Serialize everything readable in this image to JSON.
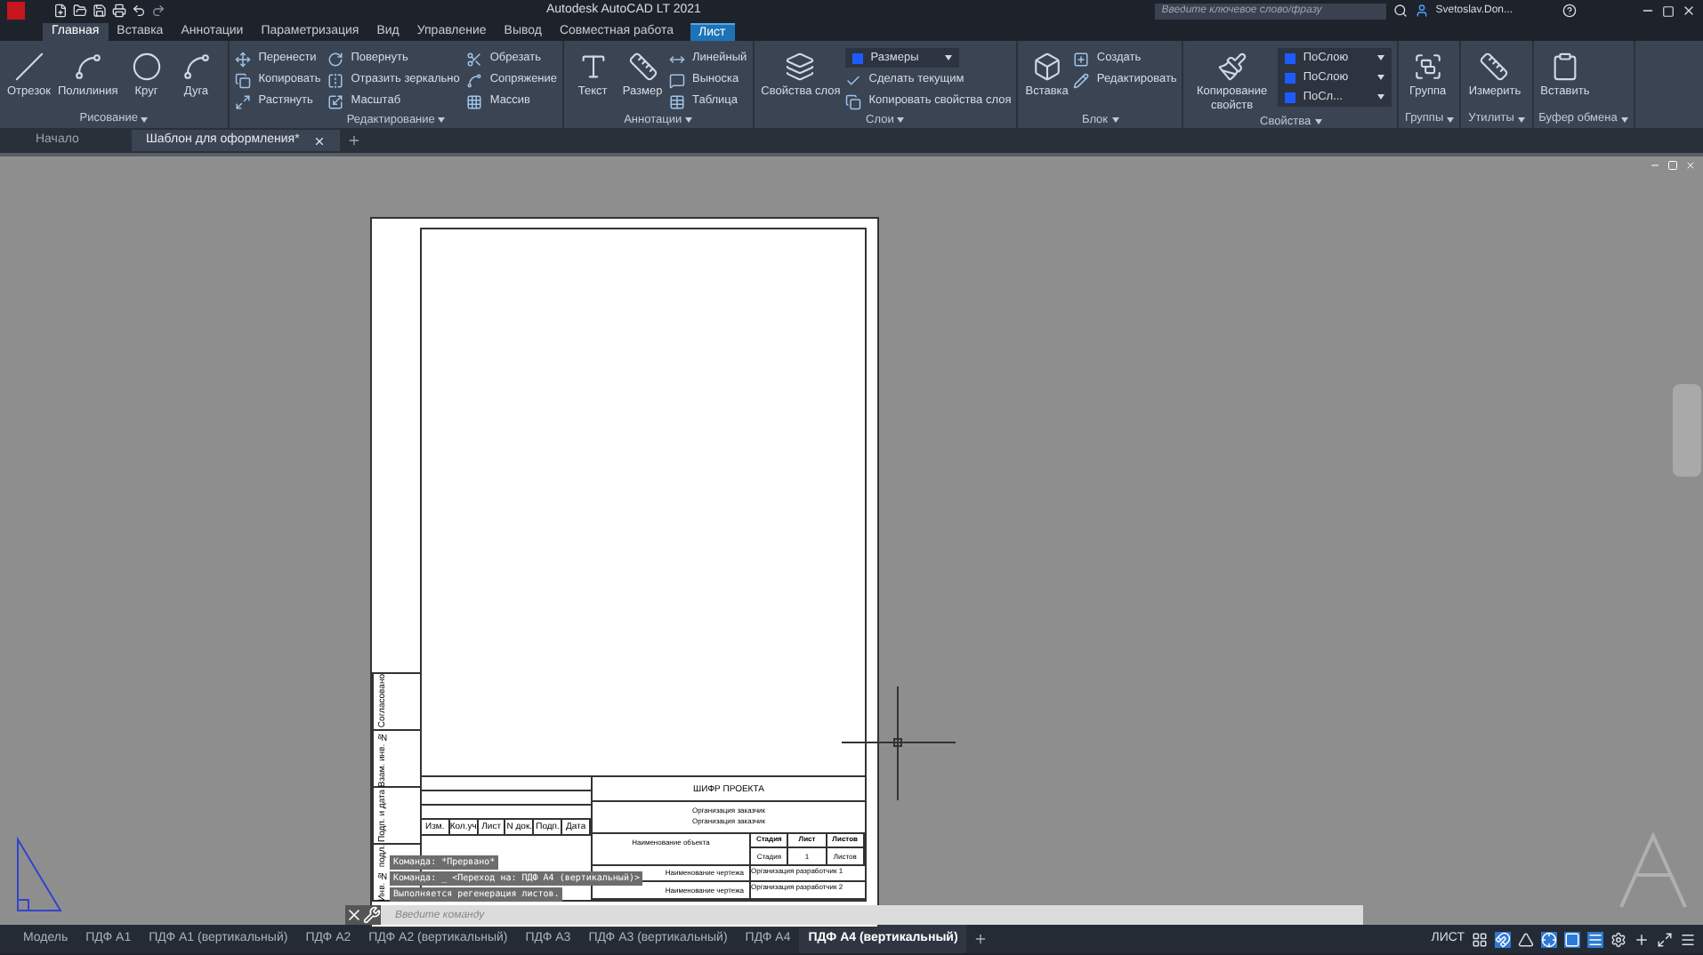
{
  "title_bar": {
    "title": "Autodesk AutoCAD LT 2021",
    "search": {
      "placeholder": "Введите ключевое слово/фразу"
    },
    "user": "Svetoslav.Don..."
  },
  "ribbon_tabs": [
    {
      "label": "Главная",
      "selected": true,
      "contextual": false
    },
    {
      "label": "Вставка",
      "selected": false,
      "contextual": false
    },
    {
      "label": "Аннотации",
      "selected": false,
      "contextual": false
    },
    {
      "label": "Параметризация",
      "selected": false,
      "contextual": false
    },
    {
      "label": "Вид",
      "selected": false,
      "contextual": false
    },
    {
      "label": "Управление",
      "selected": false,
      "contextual": false
    },
    {
      "label": "Вывод",
      "selected": false,
      "contextual": false
    },
    {
      "label": "Совместная работа",
      "selected": false,
      "contextual": false
    },
    {
      "label": "Лист",
      "selected": false,
      "contextual": true
    }
  ],
  "panels": [
    {
      "title": "Рисование",
      "tools": [
        {
          "kind": "large",
          "label": "Отрезок"
        },
        {
          "kind": "large",
          "label": "Полилиния"
        },
        {
          "kind": "large",
          "label": "Круг"
        },
        {
          "kind": "large",
          "label": "Дуга"
        }
      ]
    },
    {
      "title": "Редактирование",
      "tools": [
        {
          "kind": "small",
          "label": "Перенести"
        },
        {
          "kind": "small",
          "label": "Копировать"
        },
        {
          "kind": "small",
          "label": "Растянуть"
        },
        {
          "kind": "small",
          "label": "Повернуть"
        },
        {
          "kind": "small",
          "label": "Отразить зеркально"
        },
        {
          "kind": "small",
          "label": "Масштаб"
        },
        {
          "kind": "small",
          "label": "Обрезать"
        },
        {
          "kind": "small",
          "label": "Сопряжение"
        },
        {
          "kind": "small",
          "label": "Массив"
        }
      ]
    },
    {
      "title": "Аннотации",
      "tools": [
        {
          "kind": "large",
          "label": "Текст"
        },
        {
          "kind": "large",
          "label": "Размер"
        },
        {
          "kind": "small",
          "label": "Линейный"
        },
        {
          "kind": "small",
          "label": "Выноска"
        },
        {
          "kind": "small",
          "label": "Таблица"
        }
      ]
    },
    {
      "title": "Слои",
      "tools": [
        {
          "kind": "large",
          "label": "Свойства слоя"
        },
        {
          "kind": "dropdown",
          "label": "Размеры"
        },
        {
          "kind": "small",
          "label": "Сделать текущим"
        },
        {
          "kind": "small",
          "label": "Копировать свойства слоя"
        }
      ]
    },
    {
      "title": "Блок",
      "tools": [
        {
          "kind": "large",
          "label": "Вставка"
        },
        {
          "kind": "small",
          "label": "Создать"
        },
        {
          "kind": "small",
          "label": "Редактировать"
        }
      ]
    },
    {
      "title": "Свойства",
      "tools": [
        {
          "kind": "large",
          "label": "Копирование свойств"
        },
        {
          "kind": "dropdown",
          "label": "ПоСлою"
        },
        {
          "kind": "dropdown",
          "label": "ПоСлою"
        },
        {
          "kind": "dropdown",
          "label": "ПоСл..."
        }
      ]
    },
    {
      "title": "Группы",
      "tools": [
        {
          "kind": "large",
          "label": "Группа"
        }
      ]
    },
    {
      "title": "Утилиты",
      "tools": [
        {
          "kind": "large",
          "label": "Измерить"
        }
      ]
    },
    {
      "title": "Буфер обмена",
      "tools": [
        {
          "kind": "large",
          "label": "Вставить"
        }
      ]
    }
  ],
  "doc_tabs": [
    {
      "label": "Начало",
      "selected": false,
      "closable": false
    },
    {
      "label": "Шаблон для оформления*",
      "selected": true,
      "closable": true
    }
  ],
  "sheet": {
    "side_labels": [
      "Согласовано",
      "Взам. инв. №",
      "Подп. и дата",
      "Инв. № подл."
    ],
    "columns": [
      "Изм.",
      "Кол.уч",
      "Лист",
      "N док.",
      "Подп.",
      "Дата"
    ],
    "project_code": "ШИФР ПРОЕКТА",
    "customer": [
      "Организация заказчик",
      "Организация заказчик"
    ],
    "object_name": "Наименование объекта",
    "stage_headers": [
      "Стадия",
      "Лист",
      "Листов"
    ],
    "stage_values": [
      "Стадия",
      "1",
      "Листов"
    ],
    "drawing_names": [
      "Наименование чертежа",
      "Наименование чертежа"
    ],
    "developers": [
      "Организация разработчик 1",
      "Организация разработчик 2"
    ]
  },
  "command_history": [
    "Команда: *Прервано*",
    "Команда: _ <Переход на: ПДФ А4 (вертикальный)>",
    "Выполняется регенерация листов."
  ],
  "command_input": {
    "placeholder": "Введите команду"
  },
  "layout_tabs": [
    {
      "label": "Модель",
      "selected": false
    },
    {
      "label": "ПДФ А1",
      "selected": false
    },
    {
      "label": "ПДФ А1 (вертикальный)",
      "selected": false
    },
    {
      "label": "ПДФ А2",
      "selected": false
    },
    {
      "label": "ПДФ А2 (вертикальный)",
      "selected": false
    },
    {
      "label": "ПДФ А3",
      "selected": false
    },
    {
      "label": "ПДФ А3 (вертикальный)",
      "selected": false
    },
    {
      "label": "ПДФ А4",
      "selected": false
    },
    {
      "label": "ПДФ А4 (вертикальный)",
      "selected": true
    }
  ],
  "status_bar": {
    "space": "ЛИСТ"
  }
}
